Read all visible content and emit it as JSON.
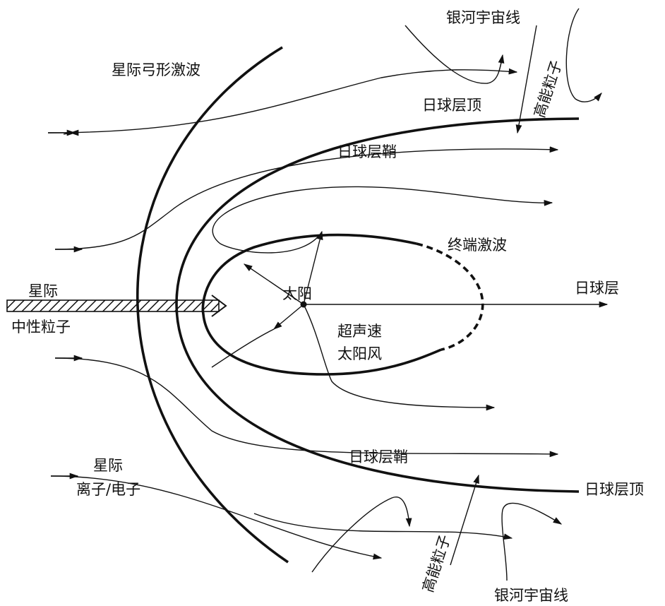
{
  "labels": {
    "bow_shock": "星际弓形激波",
    "cosmic_rays_top": "银河宇宙线",
    "cosmic_rays_bottom": "银河宇宙线",
    "energetic_particles_top": "高能粒子",
    "energetic_particles_bottom": "高能粒子",
    "heliopause_top": "日球层顶",
    "heliopause_bottom": "日球层顶",
    "heliosheath_top": "日球层鞘",
    "heliosheath_bottom": "日球层鞘",
    "termination_shock": "终端激波",
    "sun": "太阳",
    "heliosphere": "日球层",
    "supersonic_wind_line1": "超声速",
    "supersonic_wind_line2": "太阳风",
    "neutral_line1": "星际",
    "neutral_line2": "中性粒子",
    "ions_line1": "星际",
    "ions_line2": "离子/电子"
  }
}
